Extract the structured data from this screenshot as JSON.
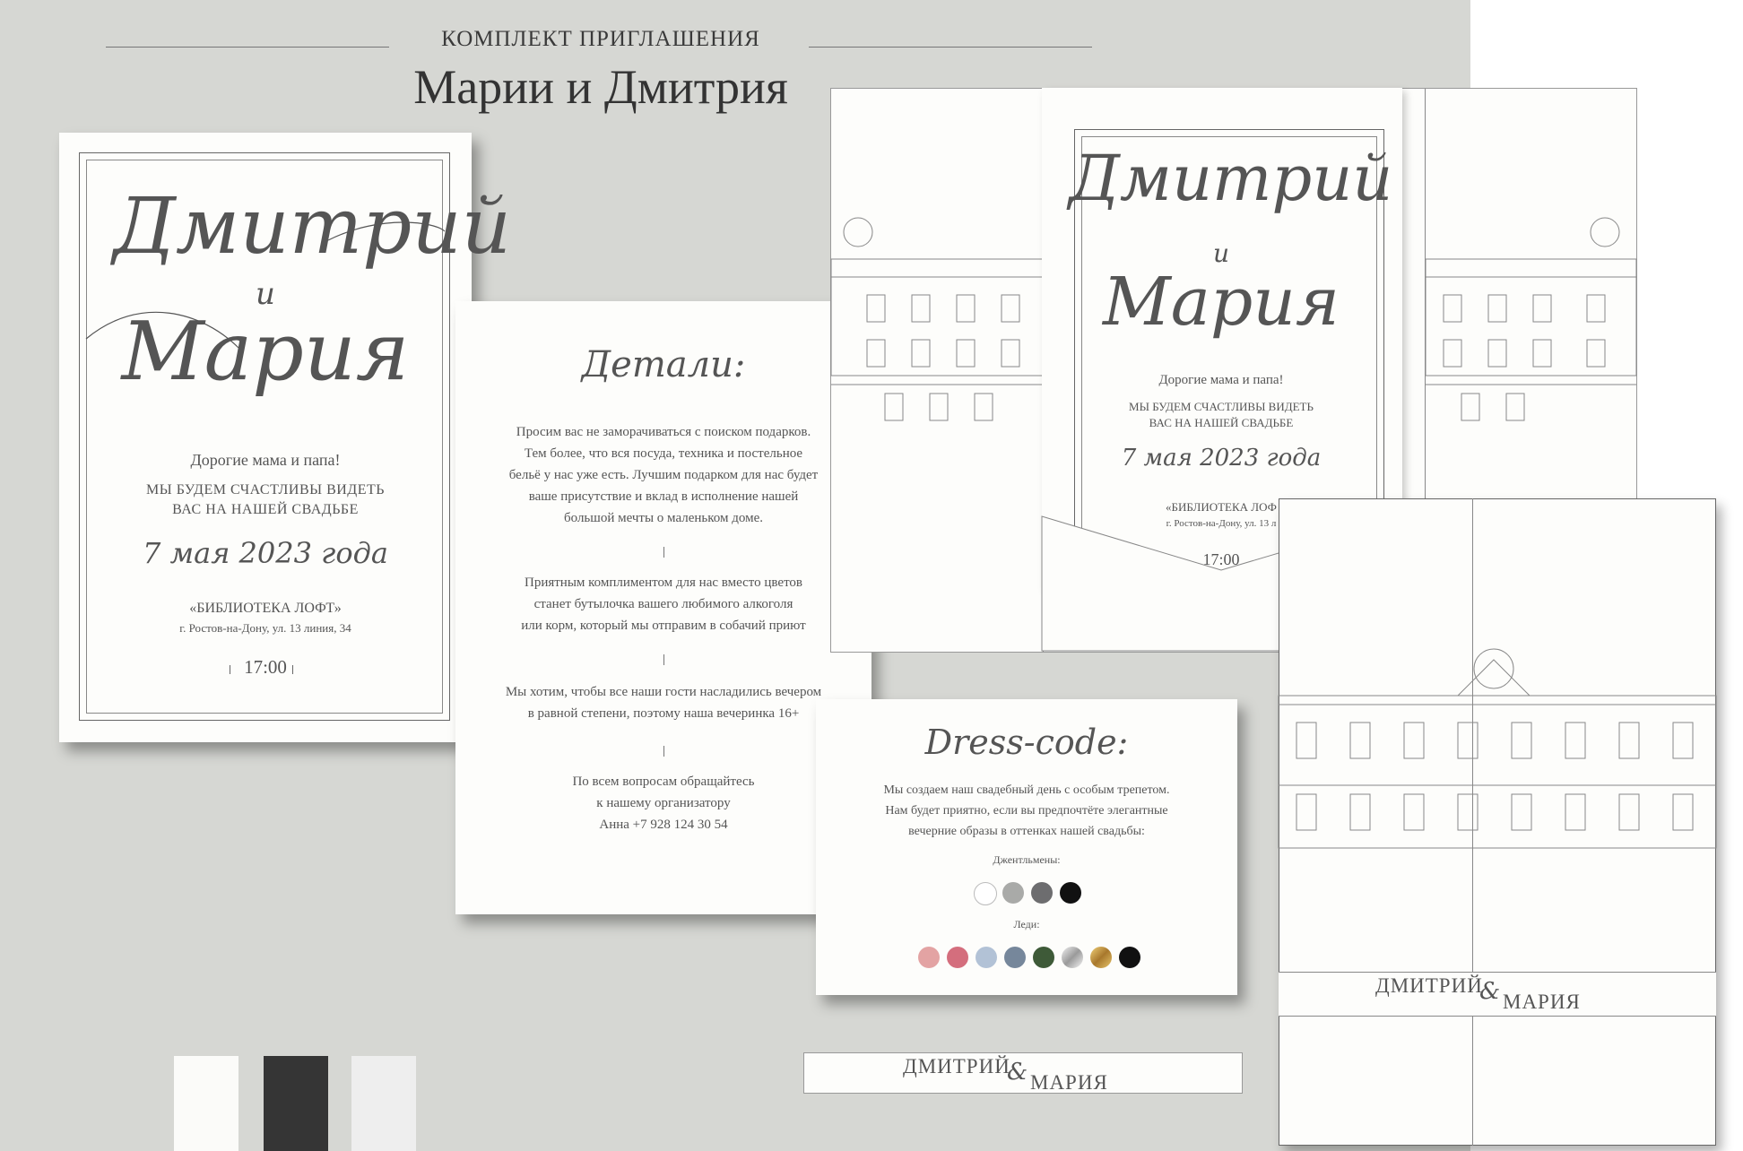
{
  "header": {
    "subtitle": "КОМПЛЕКТ ПРИГЛАШЕНИЯ",
    "title": "Марии и Дмитрия"
  },
  "main_invite": {
    "groom": "Дмитрий",
    "and": "и",
    "bride": "Мария",
    "greeting": "Дорогие мама и папа!",
    "line1": "МЫ БУДЕМ СЧАСТЛИВЫ ВИДЕТЬ",
    "line2": "ВАС НА НАШЕЙ СВАДЬБЕ",
    "date": "7 мая 2023 года",
    "venue": "«БИБЛИОТЕКА ЛОФТ»",
    "address": "г. Ростов-на-Дону, ул. 13 линия, 34",
    "time": "17:00"
  },
  "details_card": {
    "title": "Детали:",
    "p1": [
      "Просим вас не заморачиваться с поиском подарков.",
      "Тем более, что вся посуда, техника и постельное",
      "бельё у нас уже есть. Лучшим подарком для нас будет",
      "ваше присутствие и вклад в исполнение нашей",
      "большой мечты о маленьком доме."
    ],
    "p2": [
      "Приятным комплиментом для нас вместо цветов",
      "станет бутылочка вашего любимого алкоголя",
      "или корм, который мы отправим в собачий приют"
    ],
    "p3": [
      "Мы хотим, чтобы все наши гости насладились вечером",
      "в равной степени, поэтому наша вечеринка 16+"
    ],
    "p4": [
      "По всем вопросам обращайтесь",
      "к нашему организатору",
      "Анна +7 928 124 30 54"
    ]
  },
  "folder_invite": {
    "groom": "Дмитрий",
    "and": "и",
    "bride": "Мария",
    "greeting": "Дорогие мама и папа!",
    "line1": "МЫ БУДЕМ СЧАСТЛИВЫ ВИДЕТЬ",
    "line2": "ВАС НА НАШЕЙ СВАДЬБЕ",
    "date": "7 мая 2023 года",
    "venue": "«БИБЛИОТЕКА ЛОФ",
    "address": "г. Ростов-на-Дону, ул. 13 л",
    "time": "17:00"
  },
  "dress_code": {
    "title": "Dress-code:",
    "lines": [
      "Мы создаем наш свадебный день с особым трепетом.",
      "Нам будет приятно, если вы предпочтёте элегантные",
      "вечерние образы в оттенках нашей свадьбы:"
    ],
    "gentlemen_label": "Джентльмены:",
    "ladies_label": "Леди:",
    "gentlemen_colors": [
      "#ffffff",
      "#a9aaa8",
      "#6d6d6f",
      "#111111"
    ],
    "ladies_colors": [
      "#e3a3a3",
      "#d46e7d",
      "#b2c2d6",
      "#76879b",
      "#3e5a38",
      "silver",
      "gold",
      "#111111"
    ]
  },
  "belly_band": {
    "name1": "ДМИТРИЙ",
    "amp": "&",
    "name2": "МАРИЯ"
  },
  "folder_band": {
    "name1": "ДМИТРИЙ",
    "amp": "&",
    "name2": "МАРИЯ"
  },
  "palette": [
    "#fbfbf9",
    "#353535",
    "#eeeeee"
  ]
}
